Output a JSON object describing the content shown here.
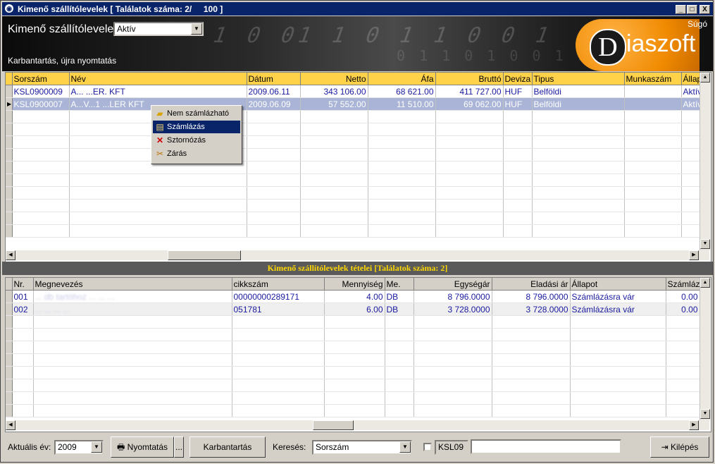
{
  "window": {
    "title": "Kimenő szállítólevelek [ Találatok száma: 2/     100 ]",
    "controls": [
      "_",
      "□",
      "X"
    ]
  },
  "header": {
    "title": "Kimenő szállítólevelek",
    "status_value": "Aktív",
    "subtitle": "Karbantartás, újra nyomtatás",
    "logo_letter": "D",
    "logo_text": "iaszoft",
    "help": "Súgó"
  },
  "top_grid": {
    "columns": [
      "Sorszám",
      "Név",
      "Dátum",
      "Netto",
      "Áfa",
      "Bruttó",
      "Deviza",
      "Tipus",
      "Munkaszám",
      "Állap"
    ],
    "rows": [
      [
        "KSL0900009",
        "A... ...ER. KFT",
        "2009.06.11",
        "343 106.00",
        "68 621.00",
        "411 727.00",
        "HUF",
        "Belföldi",
        "",
        "Aktív"
      ],
      [
        "KSL0900007",
        "A...V...1 ...LER KFT",
        "2009.06.09",
        "57 552.00",
        "11 510.00",
        "69 062.00",
        "HUF",
        "Belföldi",
        "",
        "Aktív"
      ]
    ],
    "selected_row": 1
  },
  "context_menu": {
    "items": [
      {
        "label": "Nem számlázható",
        "icon": "folder-icon"
      },
      {
        "label": "Számlázás",
        "icon": "invoice-icon"
      },
      {
        "label": "Sztornózás",
        "icon": "red-x-icon"
      },
      {
        "label": "Zárás",
        "icon": "tools-icon"
      }
    ],
    "highlighted": 1
  },
  "separator": "Kimenő szállítólevelek tételei [Találatok száma: 2]",
  "bottom_grid": {
    "columns": [
      "Nr.",
      "Megnevezés",
      "cikkszám",
      "Mennyiség",
      "Me.",
      "Egységár",
      "Eladási ár",
      "Állapot",
      "Számláz"
    ],
    "rows": [
      [
        "001",
        "... db tartóhoz ... ... ...",
        "00000000289171",
        "4.00",
        "DB",
        "8 796.0000",
        "8 796.0000",
        "Számlázásra vár",
        "0.00"
      ],
      [
        "002",
        "... ... ... ...",
        "051781",
        "6.00",
        "DB",
        "3 728.0000",
        "3 728.0000",
        "Számlázásra vár",
        "0.00"
      ]
    ]
  },
  "footer": {
    "year_label": "Aktuális év:",
    "year_value": "2009",
    "print_label": "Nyomtatás",
    "print_more": "...",
    "maintenance_label": "Karbantartás",
    "search_label": "Keresés:",
    "search_field": "Sorszám",
    "prefix": "KSL09",
    "search_value": "",
    "exit_label": "Kilépés"
  },
  "colors": {
    "title_bg": "#0a246a",
    "header_yellow": "#ffd24a",
    "selected_row": "#a9b4d6",
    "separator_text": "#ffd700",
    "logo_orange": "#f08a00"
  }
}
